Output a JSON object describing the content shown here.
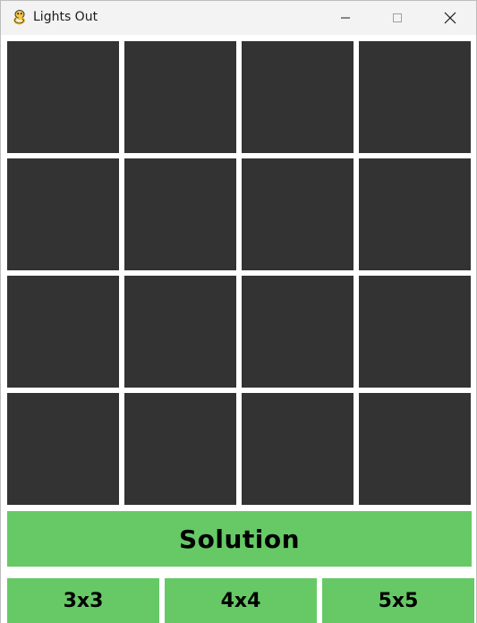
{
  "window": {
    "title": "Lights Out"
  },
  "board": {
    "size": 4,
    "cells": [
      [
        false,
        false,
        false,
        false
      ],
      [
        false,
        false,
        false,
        false
      ],
      [
        false,
        false,
        false,
        false
      ],
      [
        false,
        false,
        false,
        false
      ]
    ],
    "off_color": "#333333",
    "on_color": "#f2d64b"
  },
  "controls": {
    "solution_label": "Solution",
    "size_buttons": [
      "3x3",
      "4x4",
      "5x5"
    ],
    "button_color": "#66c966"
  }
}
